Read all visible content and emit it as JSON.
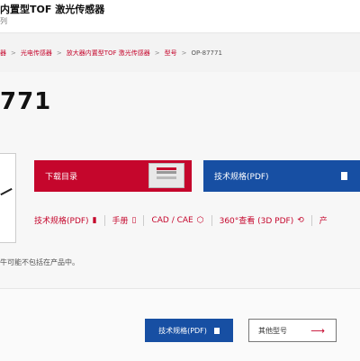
{
  "header": {
    "title": "内置型TOF 激光传感器",
    "subtitle": "列"
  },
  "breadcrumb": {
    "items": [
      "器",
      "光电传感器",
      "放大器内置型TOF 激光传感器",
      "型号"
    ],
    "current": "OP-87771",
    "separator": ">"
  },
  "product": {
    "model_number": "771"
  },
  "actions": {
    "download_catalog": "下载目录",
    "spec_pdf": "技术规格(PDF)"
  },
  "links": [
    {
      "label": "技术规格(PDF)",
      "icon": "document-icon"
    },
    {
      "label": "手册",
      "icon": "document-icon"
    },
    {
      "label": "CAD / CAE",
      "icon": "cube-icon"
    },
    {
      "label": "360°查看 (3D PDF)",
      "icon": "rotate-icon"
    },
    {
      "label": "产",
      "icon": ""
    }
  ],
  "note": "牛可能不包括在产品中。",
  "bottom": {
    "spec_pdf": "技术规格(PDF)",
    "other_models": "其他型号"
  },
  "colors": {
    "brand_red": "#c5062c",
    "brand_blue": "#174fa3"
  }
}
